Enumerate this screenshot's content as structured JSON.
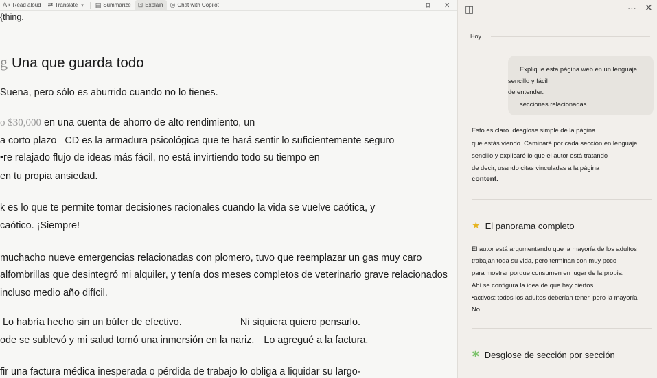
{
  "toolbar": {
    "read_aloud": "Read aloud",
    "translate": "Translate",
    "summarize": "Summarize",
    "explain": "Explain",
    "chat": "Chat with Copilot"
  },
  "article": {
    "top_fragment": "{thing.",
    "heading_glyph": "g",
    "heading": "Una que guarda todo",
    "p1": "Suena, pero sólo es aburrido cuando no lo tienes.",
    "money": "o $30,000",
    "p2a": "en una cuenta de ahorro de alto rendimiento, un",
    "p2b_a": "a corto plazo",
    "p2b_b": "CD es la armadura psicológica que te hará sentir lo suficientemente seguro",
    "p2c": "•re relajado flujo de ideas más fácil, no está invirtiendo todo su tiempo en",
    "p2d": "en tu propia ansiedad.",
    "p3a": "k es lo que te permite tomar decisiones racionales cuando la vida se vuelve caótica, y",
    "p3b": "caótico. ¡Siempre!",
    "p4a": "muchacho nueve emergencias relacionadas con plomero, tuvo que reemplazar un gas muy caro",
    "p4b": "alfombrillas que desintegró mi alquiler, y tenía dos meses completos de veterinario grave relacionados",
    "p4c": "incluso medio año difícil.",
    "p5a_a": "Lo habría hecho sin un búfer de efectivo.",
    "p5a_b": "Ni siquiera quiero pensarlo.",
    "p5b_a": "ode se sublevó y mi salud tomó una inmersión en la nariz.",
    "p5b_b": "Lo agregué a la factura.",
    "p6": "fir una factura médica inesperada o pérdida de trabajo lo obliga a liquidar su largo-"
  },
  "panel": {
    "today": "Hoy",
    "bubble": [
      "Explique esta página web en un lenguaje",
      "sencillo y fácil",
      "de entender.",
      "secciones relacionadas."
    ],
    "response": [
      "Esto es claro. desglose simple de la página",
      "que estás viendo. Caminaré por cada sección en lenguaje",
      "sencillo y explicaré lo que el autor está tratando",
      "de decir, usando citas vinculadas a la página"
    ],
    "response_bold": "content.",
    "section1_title": "El panorama completo",
    "section1_lines": [
      "El autor está argumentando que la mayoría de los adultos",
      "trabajan toda su vida, pero terminan con muy poco",
      "para mostrar porque consumen en lugar de la propia.",
      "Ahí se configura la idea de que hay ciertos",
      "•activos: todos los adultos deberían tener, pero la mayoría",
      "No."
    ],
    "section2_title": "Desglose de sección por sección"
  },
  "icons": {
    "settings": "gear-icon",
    "close": "close-icon",
    "sidebar": "sidebar-toggle-icon",
    "more": "more-icon",
    "star": "star-icon",
    "puzzle": "puzzle-icon"
  }
}
